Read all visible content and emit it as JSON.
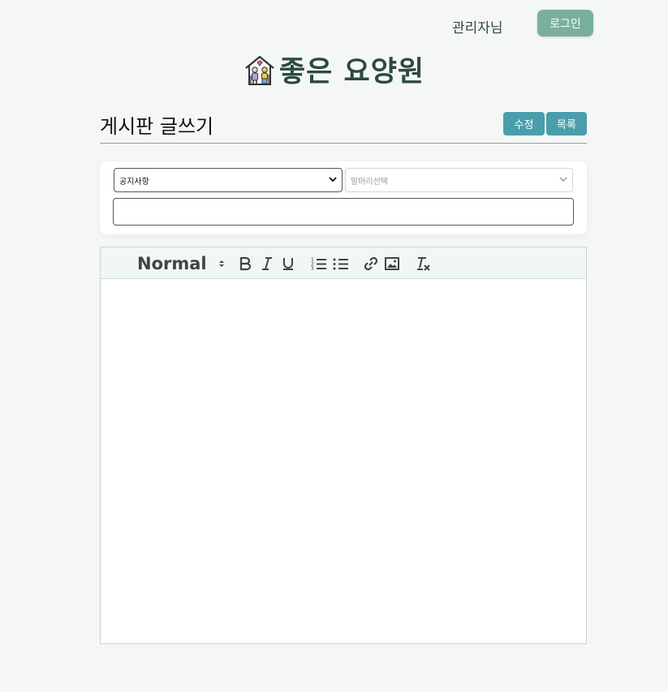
{
  "header": {
    "user_label": "관리자님",
    "login_label": "로그인"
  },
  "logo": {
    "icon": "elderly-couple-house-icon",
    "text": "좋은 요양원"
  },
  "board": {
    "title": "게시판 글쓰기",
    "edit_label": "수정",
    "list_label": "목록"
  },
  "form": {
    "category_value": "공지사항",
    "prefix_placeholder": "말머리선택",
    "title_value": ""
  },
  "editor": {
    "heading_value": "Normal",
    "tools": [
      "bold-icon",
      "italic-icon",
      "underline-icon",
      "ordered-list-icon",
      "bullet-list-icon",
      "link-icon",
      "image-icon",
      "clear-format-icon"
    ],
    "content": ""
  },
  "colors": {
    "background": "#f5f7f7",
    "brand_green": "#2c4a3e",
    "login_button": "#7aafa0",
    "teal_button": "#4a9eab",
    "toolbar_bg": "#f0f7f6"
  }
}
